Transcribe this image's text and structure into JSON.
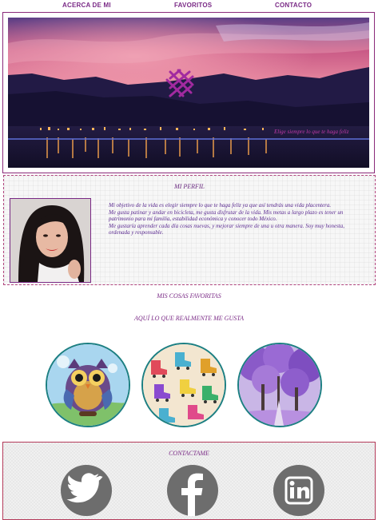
{
  "nav": {
    "about": "ACERCA DE MI",
    "favorites": "FAVORITOS",
    "contact": "CONTACTO"
  },
  "hero": {
    "motto": "Elige siempre lo que te haga feliz"
  },
  "profile": {
    "title": "MI PERFIL",
    "bio": [
      "Mi objetivo de la vida es elegir siempre lo que te haga feliz ya que así tendrás una vida placentera.",
      "Me gusta patinar y andar en bicicleta, me gusta disfrutar de la vida. Mis metas a largo plazo es tener un patrimonio para mi familia, estabilidad económica y conocer todo México.",
      "Me gustaría aprender cada día cosas nuevas, y mejorar siempre de una u otra manera. Soy muy honesta, ordenada y responsable."
    ]
  },
  "favorites": {
    "title": "MIS COSAS FAVORITAS",
    "subtitle": "AQUÍ LO QUE REALMENTE ME GUSTA",
    "items": [
      "owl",
      "roller-skates",
      "jacaranda-trees"
    ]
  },
  "contact": {
    "title": "CONTACTAME",
    "icons": [
      "twitter-icon",
      "facebook-icon",
      "linkedin-icon"
    ]
  },
  "colors": {
    "accent": "#7a2a86",
    "frame": "#8a2a7a",
    "teal": "#1c7f82",
    "social": "#6d6d6d"
  }
}
